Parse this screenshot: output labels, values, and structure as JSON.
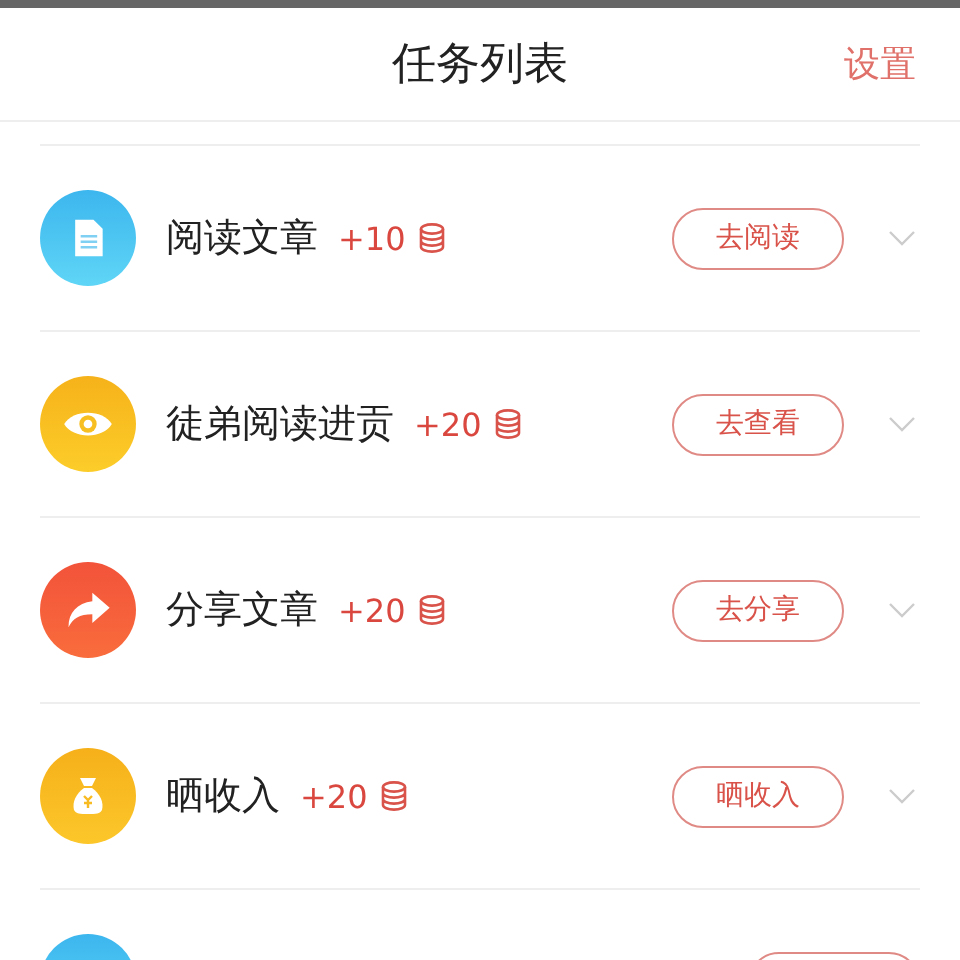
{
  "header": {
    "title": "任务列表",
    "action": "设置"
  },
  "tasks": [
    {
      "kind": "doc",
      "title": "阅读文章",
      "reward": "+10",
      "button": "去阅读",
      "expanded": false
    },
    {
      "kind": "eye",
      "title": "徒弟阅读进贡",
      "reward": "+20",
      "button": "去查看",
      "expanded": false
    },
    {
      "kind": "share",
      "title": "分享文章",
      "reward": "+20",
      "button": "去分享",
      "expanded": false
    },
    {
      "kind": "bag",
      "title": "晒收入",
      "reward": "+20",
      "button": "晒收入",
      "expanded": false
    },
    {
      "kind": "doc"
    }
  ]
}
